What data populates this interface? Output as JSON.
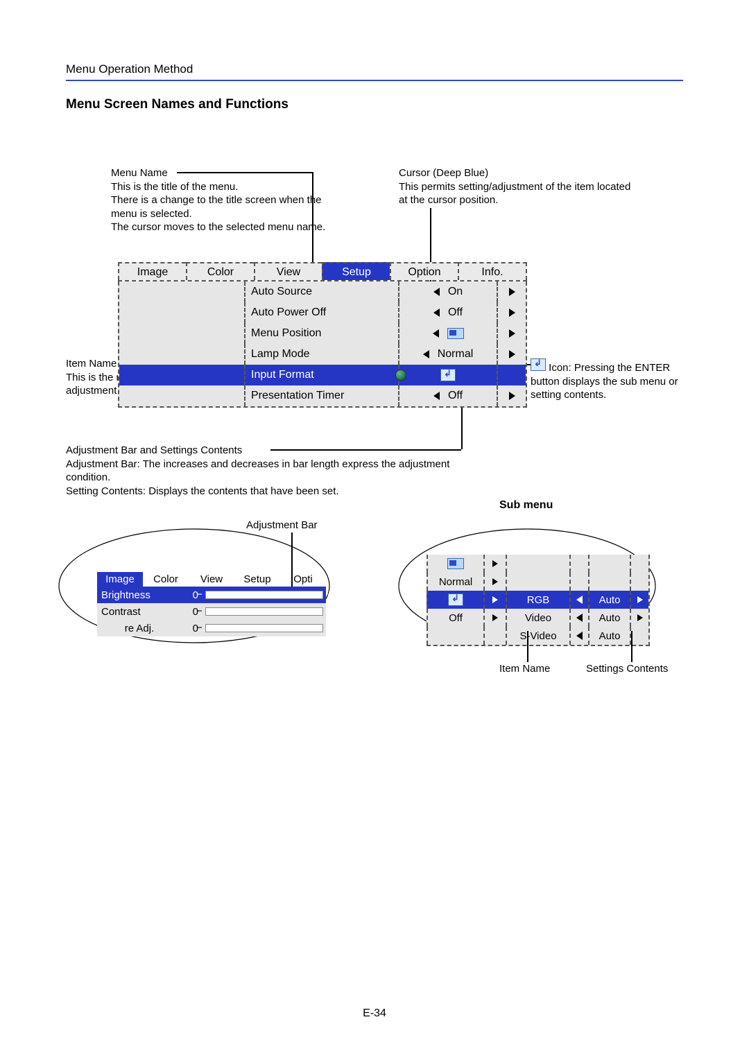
{
  "page": {
    "breadcrumb": "Menu Operation Method",
    "section_title": "Menu Screen Names and Functions",
    "page_number": "E-34"
  },
  "annotations": {
    "menu_name_title": "Menu Name",
    "menu_name_body": "This is the title of the menu.\nThere is a change to the title screen when the menu is selected.\nThe cursor moves to the selected menu name.",
    "cursor_title": "Cursor (Deep Blue)",
    "cursor_body": "This permits setting/adjustment of the item located at the cursor position.",
    "item_name_title": "Item Name",
    "item_name_body": "This is the name of the adjustment or setting.",
    "icon_label": "Icon:",
    "icon_body": "Pressing the ENTER button displays the sub menu or setting contents.",
    "adjbar_title": "Adjustment Bar and Settings Contents",
    "adjbar_body1": "Adjustment Bar: The increases and decreases in bar length express the adjustment condition.",
    "adjbar_body2": "Setting Contents: Displays the contents that have been set.",
    "adjustment_bar_label": "Adjustment Bar",
    "sub_menu_title": "Sub menu",
    "sub_item_name_label": "Item Name",
    "sub_settings_contents_label": "Settings Contents"
  },
  "main_menu": {
    "tabs": [
      "Image",
      "Color",
      "View",
      "Setup",
      "Option",
      "Info."
    ],
    "selected_tab_index": 3,
    "rows": [
      {
        "label": "Auto Source",
        "value": "On",
        "has_arrows": true,
        "icon": null
      },
      {
        "label": "Auto Power Off",
        "value": "Off",
        "has_arrows": true,
        "icon": null
      },
      {
        "label": "Menu Position",
        "value": "",
        "has_arrows": true,
        "icon": "position"
      },
      {
        "label": "Lamp Mode",
        "value": "Normal",
        "has_arrows": true,
        "icon": null
      },
      {
        "label": "Input Format",
        "value": "",
        "has_arrows": false,
        "icon": "enter",
        "highlight": true
      },
      {
        "label": "Presentation Timer",
        "value": "Off",
        "has_arrows": true,
        "icon": null
      }
    ]
  },
  "adjustment_figure": {
    "tabs": [
      "Image",
      "Color",
      "View",
      "Setup",
      "Opti"
    ],
    "selected_tab_index": 0,
    "rows": [
      {
        "name": "Brightness",
        "value": "0",
        "highlight": true
      },
      {
        "name": "Contrast",
        "value": "0",
        "highlight": false
      },
      {
        "name": "re Adj.",
        "value": "0",
        "highlight": false
      }
    ]
  },
  "sub_menu": {
    "rows": [
      {
        "left": "",
        "left_icon": "position",
        "name": "",
        "value": ""
      },
      {
        "left": "Normal",
        "left_icon": null,
        "name": "",
        "value": ""
      },
      {
        "left": "",
        "left_icon": "enter",
        "name": "RGB",
        "value": "Auto",
        "highlight": true
      },
      {
        "left": "Off",
        "left_icon": null,
        "name": "Video",
        "value": "Auto"
      },
      {
        "left": "",
        "left_icon": null,
        "name": "S-Video",
        "value": "Auto"
      }
    ]
  }
}
